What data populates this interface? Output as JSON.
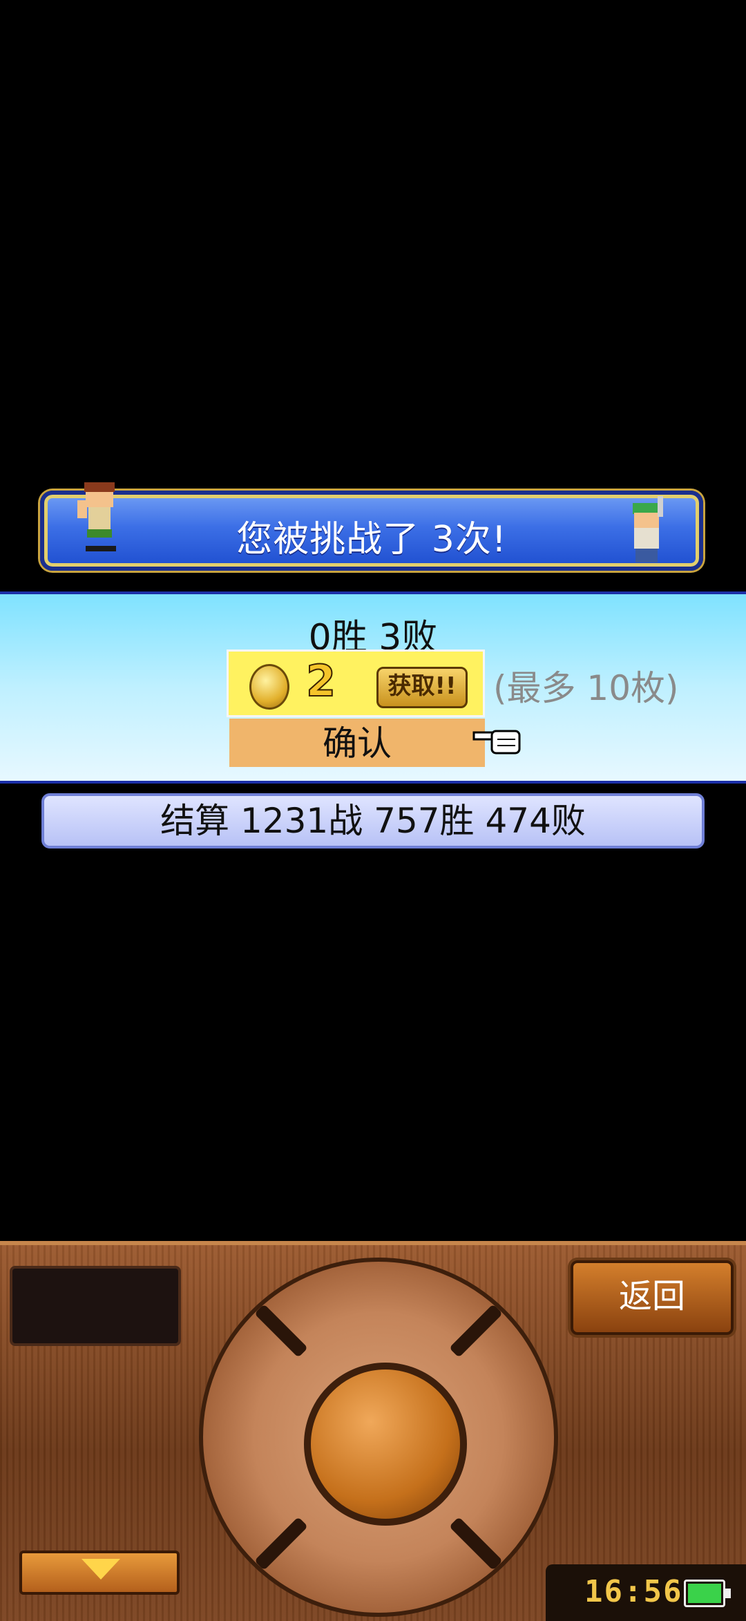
{
  "banner": {
    "title": "您被挑战了 3次!"
  },
  "result": {
    "record": "0胜 3败",
    "coin_count": "2",
    "obtain_label": "获取!!",
    "max_note": "(最多 10枚)",
    "confirm_label": "确认"
  },
  "summary": {
    "text": "结算 1231战 757胜 474败"
  },
  "controller": {
    "back_label": "返回",
    "clock": "16:56"
  },
  "icons": [
    "coin-icon",
    "pointer-hand-icon",
    "down-arrow-icon",
    "battery-icon"
  ],
  "colors": {
    "banner_blue": "#3c6fe6",
    "panel_cyan": "#7fe2ff",
    "confirm_orange": "#f0b56b",
    "wood": "#7d4522"
  }
}
